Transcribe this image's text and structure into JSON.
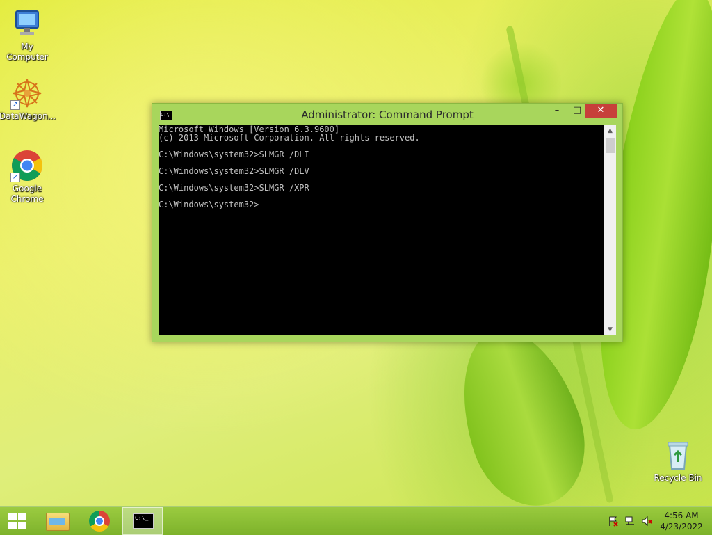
{
  "desktop": {
    "icons": [
      {
        "label": "My Computer"
      },
      {
        "label": "DataWagon..."
      },
      {
        "label": "Google Chrome"
      },
      {
        "label": "Recycle Bin"
      }
    ]
  },
  "window": {
    "title": "Administrator: Command Prompt",
    "minimize_label": "–",
    "maximize_label": "□",
    "close_label": "✕",
    "console_lines": [
      "Microsoft Windows [Version 6.3.9600]",
      "(c) 2013 Microsoft Corporation. All rights reserved.",
      "",
      "C:\\Windows\\system32>SLMGR /DLI",
      "",
      "C:\\Windows\\system32>SLMGR /DLV",
      "",
      "C:\\Windows\\system32>SLMGR /XPR",
      "",
      "C:\\Windows\\system32>"
    ]
  },
  "taskbar": {
    "items": [
      {
        "icon": "windows-start-icon"
      },
      {
        "icon": "file-explorer-icon"
      },
      {
        "icon": "chrome-icon"
      },
      {
        "icon": "command-prompt-icon",
        "active": true
      }
    ],
    "tray": {
      "time": "4:56 AM",
      "date": "4/23/2022",
      "icons": [
        "action-center-flag-icon",
        "network-icon",
        "volume-muted-icon"
      ]
    }
  },
  "colors": {
    "close_button": "#c7403a",
    "window_frame": "#a8d65c",
    "console_background": "#000000",
    "console_text": "#c0c0c0"
  }
}
